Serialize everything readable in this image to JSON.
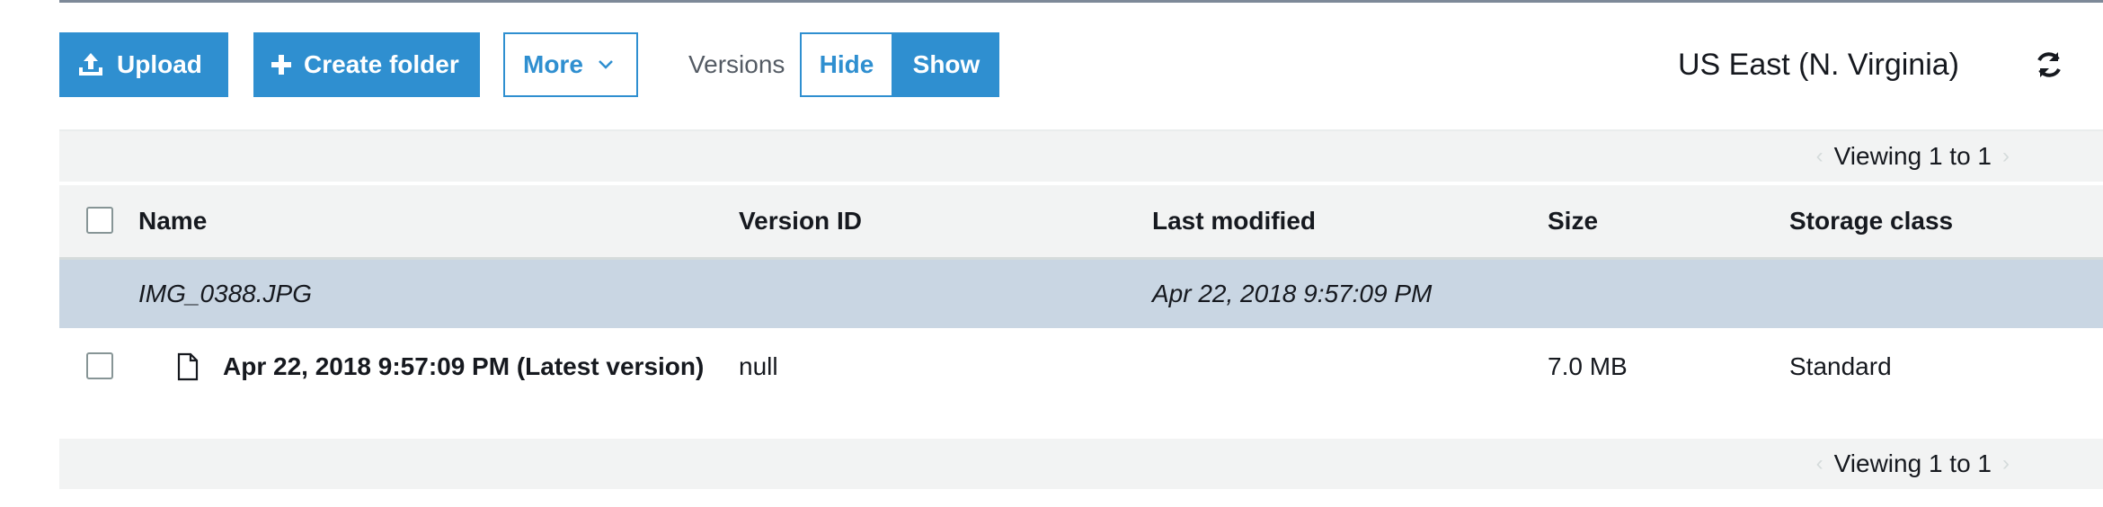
{
  "toolbar": {
    "upload_label": "Upload",
    "upload_icon": "upload-icon",
    "create_folder_label": "Create folder",
    "create_folder_icon": "plus-icon",
    "more_label": "More",
    "more_icon": "chevron-down-icon",
    "versions_label": "Versions",
    "hide_label": "Hide",
    "show_label": "Show",
    "region": "US East (N. Virginia)",
    "refresh_icon": "refresh-icon"
  },
  "pager": {
    "top_text": "Viewing 1 to 1",
    "bottom_text": "Viewing 1 to 1"
  },
  "table": {
    "columns": [
      "Name",
      "Version ID",
      "Last modified",
      "Size",
      "Storage class"
    ],
    "group": {
      "name": "IMG_0388.JPG",
      "last_modified": "Apr 22, 2018 9:57:09 PM"
    },
    "rows": [
      {
        "name": "Apr 22, 2018 9:57:09 PM (Latest version)",
        "version_id": "null",
        "last_modified": "",
        "size": "7.0 MB",
        "storage_class": "Standard",
        "icon": "file-icon"
      }
    ]
  },
  "colors": {
    "accent": "#2f8fd0",
    "selected_row": "#c9d6e3",
    "header_bg": "#f2f3f3"
  }
}
